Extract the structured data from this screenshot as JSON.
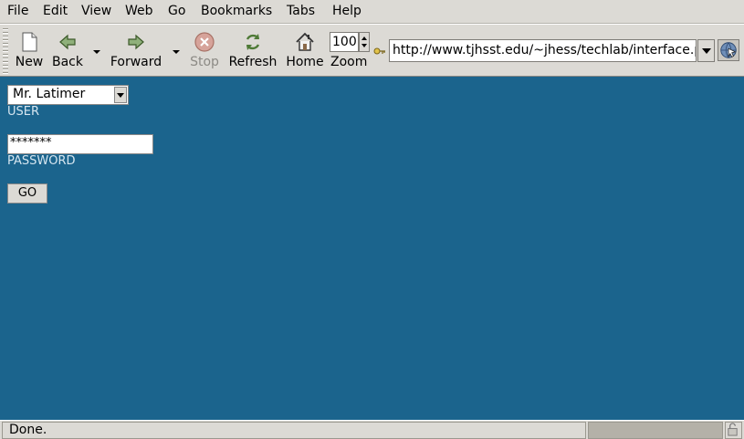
{
  "menu": {
    "file": "File",
    "edit": "Edit",
    "view": "View",
    "web": "Web",
    "go": "Go",
    "bookmarks": "Bookmarks",
    "tabs": "Tabs",
    "help": "Help"
  },
  "toolbar": {
    "new_label": "New",
    "back_label": "Back",
    "forward_label": "Forward",
    "stop_label": "Stop",
    "refresh_label": "Refresh",
    "home_label": "Home",
    "zoom_label": "Zoom",
    "zoom_value": "100",
    "url": "http://www.tjhsst.edu/~jhess/techlab/interface.php"
  },
  "form": {
    "user_selected": "Mr. Latimer",
    "user_label": "USER",
    "password_value": "*******",
    "password_label": "PASSWORD",
    "go_label": "GO"
  },
  "status": {
    "text": "Done."
  },
  "colors": {
    "page_background": "#1b648d",
    "label_text": "#d6e6f0",
    "chrome": "#dcdad5"
  },
  "icons": {
    "new": "new-page-icon",
    "back": "arrow-left-icon",
    "forward": "arrow-right-icon",
    "stop": "stop-icon",
    "refresh": "refresh-icon",
    "home": "home-icon",
    "go": "globe-go-icon",
    "site": "key-icon",
    "lock": "lock-icon"
  }
}
